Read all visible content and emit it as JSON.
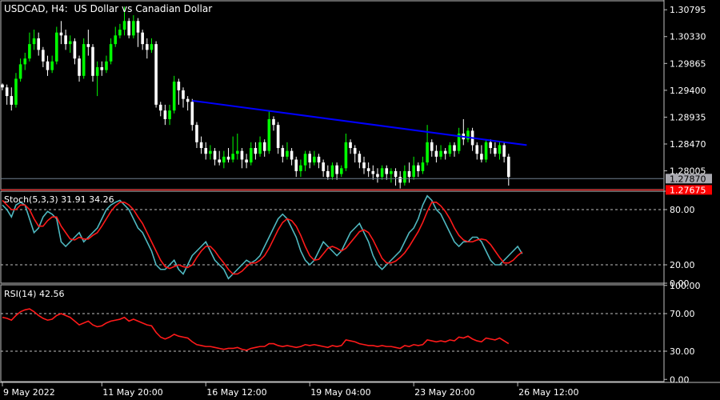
{
  "header": {
    "symbol": "USDCAD",
    "timeframe": "H4",
    "description": "US Dollar vs Canadian Dollar"
  },
  "colors": {
    "background": "#000000",
    "bull_candle": "#00ff00",
    "bear_candle": "#ffffff",
    "trendline": "#0000ff",
    "stoch_main": "#4fb8c0",
    "stoch_signal": "#ff1a1a",
    "rsi": "#ff1a1a",
    "bid_line": "#708090",
    "ask_line": "#ff0000",
    "grid": "#c0c0c0"
  },
  "chart_data": [
    {
      "type": "candlestick",
      "name": "USDCAD, H4",
      "ylim": [
        1.2768,
        1.3095
      ],
      "y_ticks": [
        "1.30795",
        "1.30330",
        "1.29865",
        "1.29400",
        "1.28935",
        "1.28470",
        "1.28005"
      ],
      "x_ticks": [
        "9 May 2022",
        "11 May 20:00",
        "16 May 12:00",
        "19 May 04:00",
        "23 May 20:00",
        "26 May 12:00"
      ],
      "current_bid": "1.27870",
      "current_ask": "1.27675",
      "trendline": {
        "start": {
          "candle": 42,
          "price": 1.2922
        },
        "end": {
          "candle": 116,
          "price": 1.2845
        }
      },
      "candles": [
        [
          1.295,
          1.2945,
          1.2952,
          1.294
        ],
        [
          1.2945,
          1.293,
          1.295,
          1.2915
        ],
        [
          1.293,
          1.2915,
          1.2945,
          1.2905
        ],
        [
          1.2915,
          1.296,
          1.297,
          1.291
        ],
        [
          1.296,
          1.2985,
          1.2995,
          1.2955
        ],
        [
          1.2985,
          1.2995,
          1.3005,
          1.2975
        ],
        [
          1.2995,
          1.302,
          1.304,
          1.299
        ],
        [
          1.302,
          1.303,
          1.3045,
          1.301
        ],
        [
          1.303,
          1.301,
          1.304,
          1.3
        ],
        [
          1.301,
          1.299,
          1.3015,
          1.298
        ],
        [
          1.299,
          1.2975,
          1.3,
          1.2965
        ],
        [
          1.2975,
          1.299,
          1.3,
          1.297
        ],
        [
          1.299,
          1.304,
          1.305,
          1.2985
        ],
        [
          1.304,
          1.3035,
          1.306,
          1.302
        ],
        [
          1.3035,
          1.302,
          1.3045,
          1.301
        ],
        [
          1.302,
          1.3025,
          1.3035,
          1.3005
        ],
        [
          1.3025,
          1.2995,
          1.303,
          1.2985
        ],
        [
          1.2995,
          1.2965,
          1.3,
          1.2955
        ],
        [
          1.2965,
          1.302,
          1.303,
          1.296
        ],
        [
          1.302,
          1.3015,
          1.3045,
          1.3
        ],
        [
          1.3015,
          1.2965,
          1.302,
          1.2955
        ],
        [
          1.2965,
          1.298,
          1.299,
          1.293
        ],
        [
          1.298,
          1.2975,
          1.299,
          1.2965
        ],
        [
          1.2975,
          1.299,
          1.3,
          1.297
        ],
        [
          1.299,
          1.302,
          1.303,
          1.2985
        ],
        [
          1.302,
          1.3035,
          1.305,
          1.3015
        ],
        [
          1.3035,
          1.3045,
          1.3055,
          1.303
        ],
        [
          1.3045,
          1.306,
          1.3085,
          1.3035
        ],
        [
          1.306,
          1.3035,
          1.3065,
          1.303
        ],
        [
          1.3035,
          1.306,
          1.307,
          1.303
        ],
        [
          1.306,
          1.304,
          1.3065,
          1.3015
        ],
        [
          1.304,
          1.302,
          1.3045,
          1.301
        ],
        [
          1.302,
          1.301,
          1.303,
          1.2995
        ],
        [
          1.301,
          1.302,
          1.303,
          1.3005
        ],
        [
          1.302,
          1.2915,
          1.3025,
          1.291
        ],
        [
          1.2915,
          1.2905,
          1.292,
          1.2895
        ],
        [
          1.2905,
          1.289,
          1.2915,
          1.288
        ],
        [
          1.289,
          1.2905,
          1.2915,
          1.288
        ],
        [
          1.2905,
          1.2955,
          1.2965,
          1.29
        ],
        [
          1.2955,
          1.294,
          1.296,
          1.2915
        ],
        [
          1.294,
          1.2925,
          1.2945,
          1.291
        ],
        [
          1.2925,
          1.292,
          1.293,
          1.2905
        ],
        [
          1.292,
          1.288,
          1.2925,
          1.287
        ],
        [
          1.288,
          1.285,
          1.2885,
          1.284
        ],
        [
          1.285,
          1.284,
          1.286,
          1.283
        ],
        [
          1.284,
          1.283,
          1.285,
          1.282
        ],
        [
          1.283,
          1.2835,
          1.2845,
          1.282
        ],
        [
          1.2835,
          1.282,
          1.284,
          1.281
        ],
        [
          1.282,
          1.2815,
          1.2835,
          1.281
        ],
        [
          1.2815,
          1.2825,
          1.2835,
          1.2805
        ],
        [
          1.2825,
          1.282,
          1.284,
          1.2815
        ],
        [
          1.282,
          1.283,
          1.286,
          1.2815
        ],
        [
          1.283,
          1.2835,
          1.2865,
          1.282
        ],
        [
          1.2835,
          1.282,
          1.284,
          1.2805
        ],
        [
          1.282,
          1.2815,
          1.283,
          1.2805
        ],
        [
          1.2815,
          1.284,
          1.285,
          1.281
        ],
        [
          1.284,
          1.283,
          1.285,
          1.282
        ],
        [
          1.283,
          1.285,
          1.286,
          1.2825
        ],
        [
          1.285,
          1.2835,
          1.2855,
          1.2825
        ],
        [
          1.2835,
          1.289,
          1.2905,
          1.283
        ],
        [
          1.289,
          1.288,
          1.2895,
          1.287
        ],
        [
          1.288,
          1.284,
          1.2885,
          1.283
        ],
        [
          1.284,
          1.2825,
          1.2845,
          1.2815
        ],
        [
          1.2825,
          1.2835,
          1.285,
          1.282
        ],
        [
          1.2835,
          1.282,
          1.284,
          1.281
        ],
        [
          1.282,
          1.28,
          1.2825,
          1.279
        ],
        [
          1.28,
          1.281,
          1.282,
          1.279
        ],
        [
          1.281,
          1.283,
          1.2835,
          1.28
        ],
        [
          1.283,
          1.2815,
          1.2835,
          1.2805
        ],
        [
          1.2815,
          1.2825,
          1.2835,
          1.281
        ],
        [
          1.2825,
          1.2815,
          1.283,
          1.2805
        ],
        [
          1.2815,
          1.28,
          1.282,
          1.279
        ],
        [
          1.28,
          1.279,
          1.281,
          1.2785
        ],
        [
          1.279,
          1.281,
          1.2815,
          1.2785
        ],
        [
          1.281,
          1.2795,
          1.2815,
          1.2785
        ],
        [
          1.2795,
          1.2805,
          1.281,
          1.279
        ],
        [
          1.2805,
          1.285,
          1.2865,
          1.28
        ],
        [
          1.285,
          1.284,
          1.2855,
          1.283
        ],
        [
          1.284,
          1.283,
          1.2845,
          1.2815
        ],
        [
          1.283,
          1.2815,
          1.2835,
          1.2805
        ],
        [
          1.2815,
          1.2805,
          1.2825,
          1.2795
        ],
        [
          1.2805,
          1.28,
          1.2815,
          1.279
        ],
        [
          1.28,
          1.2795,
          1.281,
          1.2785
        ],
        [
          1.2795,
          1.279,
          1.2805,
          1.278
        ],
        [
          1.279,
          1.2805,
          1.281,
          1.2785
        ],
        [
          1.2805,
          1.2795,
          1.281,
          1.2785
        ],
        [
          1.2795,
          1.28,
          1.2805,
          1.278
        ],
        [
          1.28,
          1.279,
          1.2805,
          1.2775
        ],
        [
          1.279,
          1.278,
          1.28,
          1.277
        ],
        [
          1.278,
          1.28,
          1.281,
          1.2775
        ],
        [
          1.28,
          1.279,
          1.2815,
          1.278
        ],
        [
          1.279,
          1.281,
          1.2825,
          1.2785
        ],
        [
          1.281,
          1.28,
          1.2815,
          1.279
        ],
        [
          1.28,
          1.2815,
          1.2825,
          1.2795
        ],
        [
          1.2815,
          1.285,
          1.288,
          1.281
        ],
        [
          1.285,
          1.2835,
          1.2855,
          1.2825
        ],
        [
          1.2835,
          1.2825,
          1.2845,
          1.2815
        ],
        [
          1.2825,
          1.2835,
          1.2845,
          1.282
        ],
        [
          1.2835,
          1.283,
          1.284,
          1.282
        ],
        [
          1.283,
          1.2845,
          1.285,
          1.2825
        ],
        [
          1.2845,
          1.2835,
          1.285,
          1.2825
        ],
        [
          1.2835,
          1.2865,
          1.2875,
          1.283
        ],
        [
          1.2865,
          1.2855,
          1.289,
          1.2845
        ],
        [
          1.2855,
          1.287,
          1.2875,
          1.285
        ],
        [
          1.287,
          1.2845,
          1.2875,
          1.2835
        ],
        [
          1.2845,
          1.283,
          1.285,
          1.282
        ],
        [
          1.283,
          1.282,
          1.2845,
          1.2815
        ],
        [
          1.282,
          1.285,
          1.2855,
          1.2815
        ],
        [
          1.285,
          1.284,
          1.2855,
          1.283
        ],
        [
          1.284,
          1.283,
          1.285,
          1.2825
        ],
        [
          1.283,
          1.2845,
          1.285,
          1.282
        ],
        [
          1.2845,
          1.2825,
          1.285,
          1.2815
        ],
        [
          1.2825,
          1.279,
          1.283,
          1.2775
        ]
      ]
    },
    {
      "type": "line",
      "name": "Stoch(5,3,3)",
      "main_value": "31.91",
      "signal_value": "34.26",
      "ylim": [
        0,
        100
      ],
      "y_ticks": [
        "100.00",
        "80.00",
        "20.00",
        "0.00"
      ],
      "levels": [
        80,
        20
      ],
      "series": [
        {
          "name": "main",
          "values": [
            85,
            80,
            72,
            85,
            88,
            85,
            70,
            55,
            60,
            72,
            78,
            75,
            70,
            45,
            40,
            45,
            50,
            55,
            45,
            50,
            55,
            60,
            70,
            80,
            85,
            88,
            90,
            85,
            80,
            70,
            60,
            55,
            45,
            35,
            20,
            15,
            15,
            20,
            25,
            15,
            10,
            20,
            30,
            35,
            40,
            45,
            35,
            25,
            20,
            15,
            5,
            10,
            15,
            20,
            25,
            22,
            25,
            30,
            40,
            50,
            60,
            70,
            75,
            70,
            60,
            50,
            35,
            25,
            20,
            25,
            35,
            45,
            40,
            35,
            30,
            35,
            45,
            55,
            60,
            65,
            55,
            45,
            30,
            20,
            15,
            20,
            25,
            30,
            35,
            45,
            55,
            60,
            70,
            85,
            95,
            90,
            80,
            75,
            65,
            55,
            45,
            40,
            45,
            45,
            50,
            50,
            45,
            35,
            25,
            20,
            20,
            25,
            30,
            35,
            40,
            32
          ]
        },
        {
          "name": "signal",
          "values": [
            90,
            85,
            80,
            80,
            85,
            85,
            80,
            70,
            62,
            62,
            68,
            72,
            72,
            62,
            55,
            48,
            47,
            50,
            48,
            48,
            52,
            55,
            62,
            70,
            78,
            84,
            88,
            88,
            85,
            80,
            72,
            65,
            55,
            45,
            35,
            25,
            18,
            16,
            18,
            20,
            18,
            17,
            20,
            28,
            35,
            40,
            40,
            35,
            28,
            22,
            15,
            10,
            10,
            13,
            18,
            22,
            22,
            25,
            30,
            38,
            48,
            58,
            66,
            70,
            68,
            62,
            52,
            40,
            30,
            25,
            26,
            32,
            38,
            40,
            38,
            35,
            38,
            44,
            50,
            56,
            58,
            55,
            47,
            37,
            27,
            22,
            22,
            24,
            28,
            33,
            40,
            48,
            56,
            66,
            78,
            88,
            88,
            84,
            78,
            70,
            60,
            52,
            47,
            45,
            45,
            47,
            48,
            47,
            42,
            35,
            28,
            22,
            22,
            25,
            30,
            34
          ]
        }
      ]
    },
    {
      "type": "line",
      "name": "RSI(14)",
      "value": "42.56",
      "ylim": [
        0,
        100
      ],
      "y_ticks": [
        "100.00",
        "70.00",
        "30.00",
        "0.00"
      ],
      "levels": [
        70,
        30
      ],
      "series": [
        {
          "name": "RSI",
          "values": [
            66,
            65,
            63,
            68,
            72,
            74,
            75,
            72,
            68,
            65,
            63,
            64,
            68,
            70,
            68,
            66,
            62,
            58,
            60,
            62,
            58,
            56,
            57,
            60,
            62,
            63,
            64,
            66,
            62,
            64,
            62,
            60,
            58,
            57,
            50,
            45,
            43,
            45,
            48,
            46,
            45,
            44,
            40,
            37,
            36,
            35,
            35,
            34,
            33,
            32,
            33,
            33,
            34,
            32,
            31,
            33,
            34,
            35,
            35,
            38,
            38,
            36,
            35,
            36,
            35,
            34,
            35,
            37,
            36,
            37,
            36,
            35,
            34,
            36,
            35,
            36,
            42,
            41,
            40,
            38,
            37,
            36,
            36,
            35,
            36,
            35,
            35,
            34,
            33,
            36,
            35,
            37,
            36,
            37,
            42,
            41,
            40,
            41,
            40,
            42,
            41,
            45,
            44,
            46,
            43,
            41,
            40,
            44,
            43,
            42,
            44,
            41,
            38
          ]
        }
      ]
    }
  ]
}
